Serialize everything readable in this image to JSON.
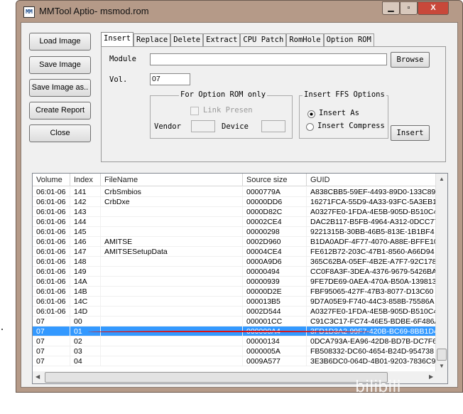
{
  "window": {
    "title": "MMTool Aptio- msmod.rom",
    "app_icon": "MM",
    "controls": {
      "minimize": "▁",
      "maximize": "▫",
      "close": "X"
    }
  },
  "left_buttons": [
    "Load Image",
    "Save Image",
    "Save Image as..",
    "Create Report",
    "Close"
  ],
  "tabs": [
    "Insert",
    "Replace",
    "Delete",
    "Extract",
    "CPU Patch",
    "RomHole",
    "Option ROM"
  ],
  "active_tab": "Insert",
  "insert_panel": {
    "module_label": "Module",
    "module_value": "",
    "browse_label": "Browse",
    "vol_label": "Vol.",
    "vol_value": "07",
    "option_rom_group": {
      "title": "For Option ROM only",
      "link_present": "Link Presen",
      "vendor_label": "Vendor",
      "device_label": "Device",
      "vendor_value": "",
      "device_value": ""
    },
    "ffs_group": {
      "title": "Insert FFS Options",
      "insert_as": "Insert As",
      "insert_compress": "Insert Compress",
      "selected": "Insert As"
    },
    "insert_label": "Insert"
  },
  "list": {
    "columns": [
      "Volume",
      "Index",
      "FileName",
      "Source size",
      "GUID"
    ],
    "rows": [
      [
        "06:01-06",
        "141",
        "CrbSmbios",
        "0000779A",
        "A838CBB5-59EF-4493-89D0-133C89"
      ],
      [
        "06:01-06",
        "142",
        "CrbDxe",
        "00000DD6",
        "16271FCA-55D9-4A33-93FC-5A3EB1"
      ],
      [
        "06:01-06",
        "143",
        "",
        "0000D82C",
        "A0327FE0-1FDA-4E5B-905D-B510C4"
      ],
      [
        "06:01-06",
        "144",
        "",
        "00002CE4",
        "DAC2B117-B5FB-4964-A312-0DCC77"
      ],
      [
        "06:01-06",
        "145",
        "",
        "00000298",
        "9221315B-30BB-46B5-813E-1B1BF4"
      ],
      [
        "06:01-06",
        "146",
        "AMITSE",
        "0002D960",
        "B1DA0ADF-4F77-4070-A88E-BFFE10"
      ],
      [
        "06:01-06",
        "147",
        "AMITSESetupData",
        "00004CE4",
        "FE612B72-203C-47B1-8560-A66D94"
      ],
      [
        "06:01-06",
        "148",
        "",
        "0000A9D6",
        "365C62BA-05EF-4B2E-A7F7-92C178"
      ],
      [
        "06:01-06",
        "149",
        "",
        "00000494",
        "CC0F8A3F-3DEA-4376-9679-5426BA"
      ],
      [
        "06:01-06",
        "14A",
        "",
        "00000939",
        "9FE7DE69-0AEA-470A-B50A-139813"
      ],
      [
        "06:01-06",
        "14B",
        "",
        "00000D2E",
        "FBF95065-427F-47B3-8077-D13C60"
      ],
      [
        "06:01-06",
        "14C",
        "",
        "000013B5",
        "9D7A05E9-F740-44C3-858B-75586A"
      ],
      [
        "06:01-06",
        "14D",
        "",
        "0002D544",
        "A0327FE0-1FDA-4E5B-905D-B510C4"
      ],
      [
        "07",
        "00",
        "",
        "000001CC",
        "C91C3C17-FC74-46E5-BDBE-6F486A"
      ],
      [
        "07",
        "01",
        "",
        "000000A4",
        "3FD1D3A2-99F7-420B-BC69-8BB1D4"
      ],
      [
        "07",
        "02",
        "",
        "00000134",
        "0DCA793A-EA96-42D8-BD7B-DC7F6"
      ],
      [
        "07",
        "03",
        "",
        "0000005A",
        "FB508332-DC60-4654-B24D-954738"
      ],
      [
        "07",
        "04",
        "",
        "0009A577",
        "3E3B6DC0-064D-4B01-9203-7836C9"
      ]
    ],
    "selected_index": 14
  },
  "watermark": "bilibili xmaojian"
}
